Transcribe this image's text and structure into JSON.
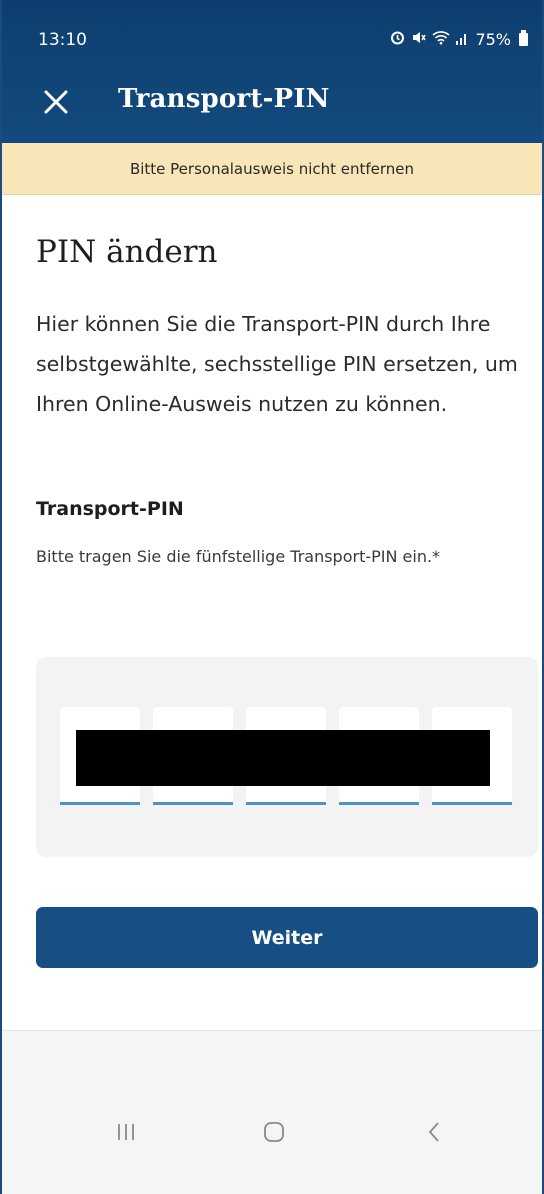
{
  "status_bar": {
    "time": "13:10",
    "battery": "75%",
    "icons": [
      "alarm-icon",
      "mute-icon",
      "wifi-icon",
      "signal-icon",
      "battery-icon"
    ]
  },
  "app_bar": {
    "title": "Transport-PIN",
    "close_icon": "close-icon"
  },
  "notice": {
    "text": "Bitte Personalausweis nicht entfernen",
    "background": "#f8e6b8"
  },
  "main": {
    "heading": "PIN ändern",
    "intro": "Hier können Sie die Transport-PIN durch Ihre selbstgewählte, sechsstellige PIN ersetzen, um Ihren Online-Ausweis nutzen zu können.",
    "field": {
      "label": "Transport-PIN",
      "hint": "Bitte tragen Sie die fünfstellige Transport-PIN ein.*",
      "digit_count": 5
    },
    "submit_label": "Weiter"
  },
  "colors": {
    "header": "#134a7e",
    "button": "#174f85",
    "pin_underline": "#4e93c7"
  },
  "nav_bar": {
    "buttons": [
      "recent-apps-icon",
      "home-icon",
      "back-icon"
    ]
  }
}
